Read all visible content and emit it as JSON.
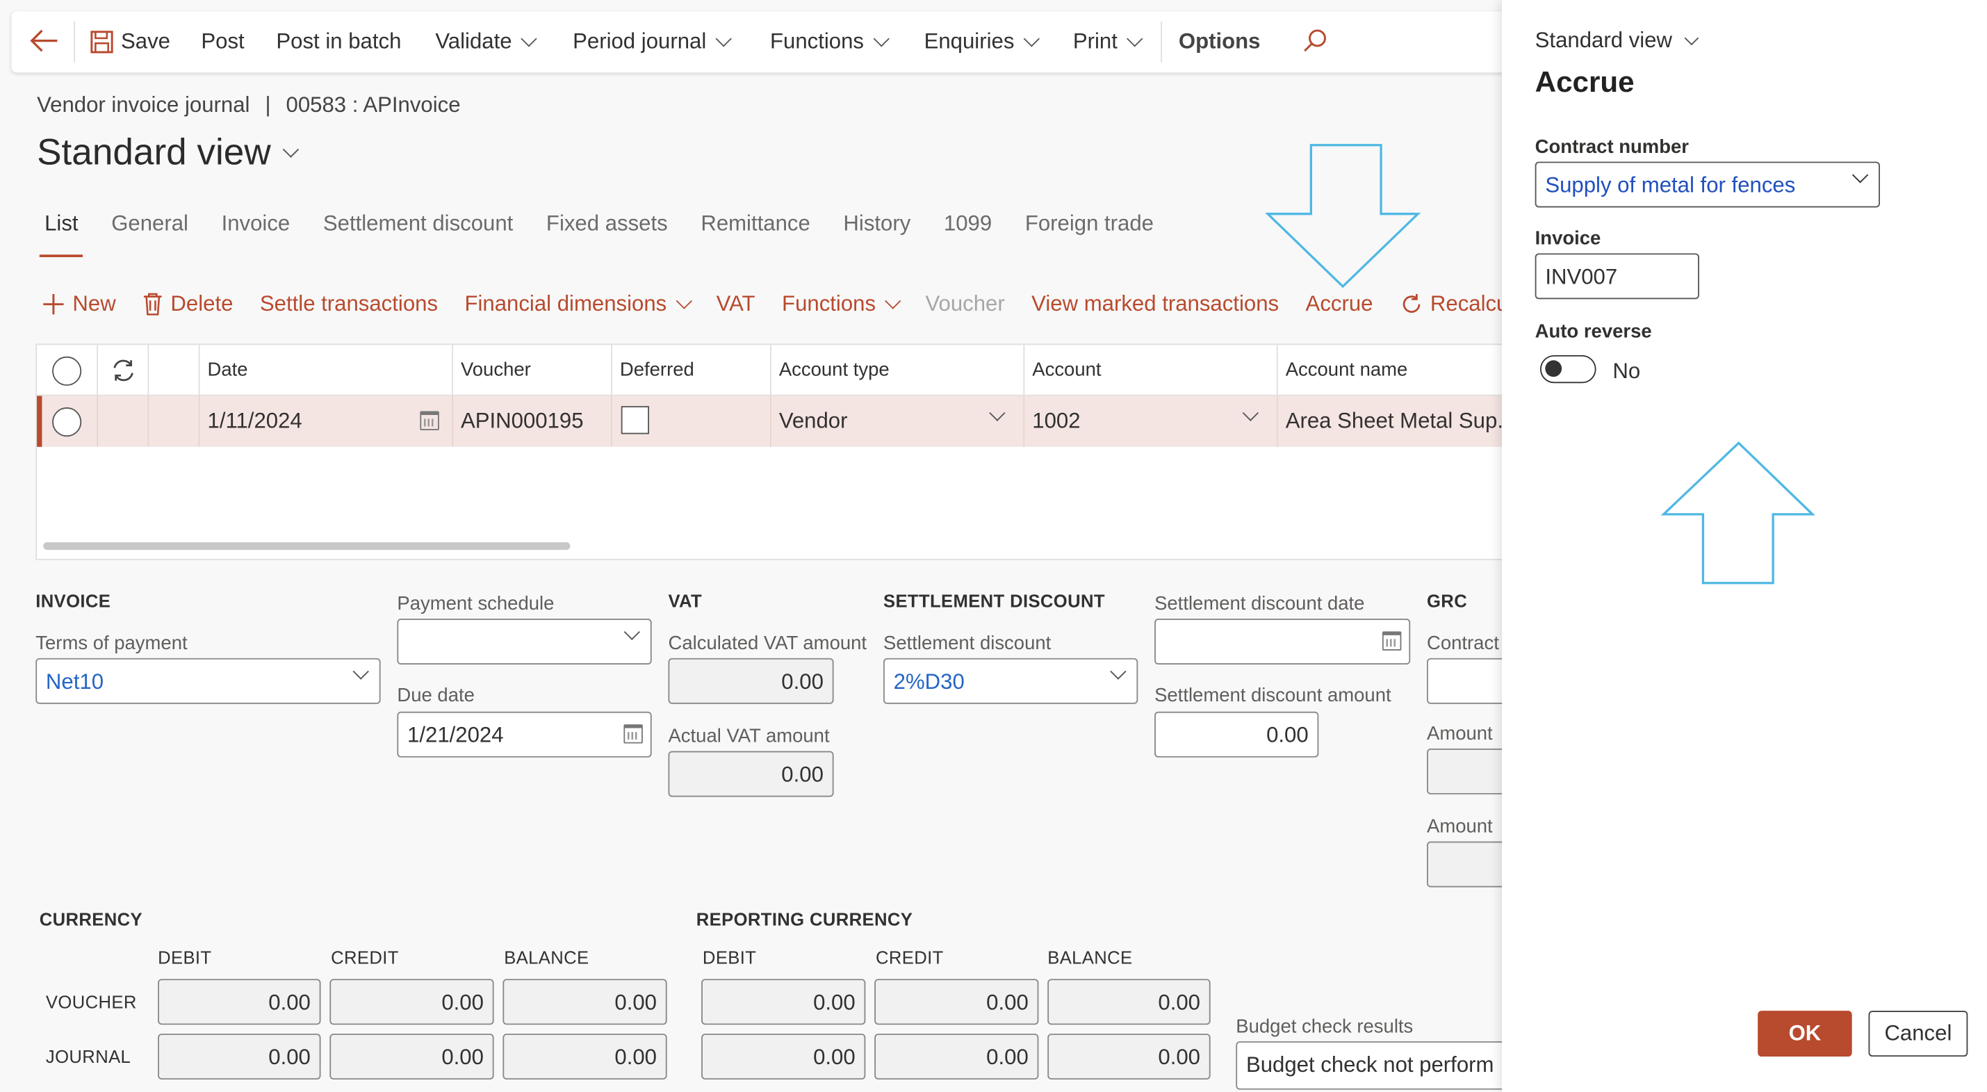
{
  "toolbar": {
    "save": "Save",
    "post": "Post",
    "post_in_batch": "Post in batch",
    "validate": "Validate",
    "period_journal": "Period journal",
    "functions": "Functions",
    "enquiries": "Enquiries",
    "print": "Print",
    "options": "Options",
    "icons": [
      "back-arrow-icon",
      "save-icon",
      "search-icon"
    ]
  },
  "breadcrumb": {
    "journal": "Vendor invoice journal",
    "separator": "|",
    "batch": "00583 : APInvoice"
  },
  "view_title": "Standard view",
  "tabs": [
    "List",
    "General",
    "Invoice",
    "Settlement discount",
    "Fixed assets",
    "Remittance",
    "History",
    "1099",
    "Foreign trade"
  ],
  "actions": {
    "new": "New",
    "delete": "Delete",
    "settle_transactions": "Settle transactions",
    "financial_dimensions": "Financial dimensions",
    "vat": "VAT",
    "functions": "Functions",
    "voucher": "Voucher",
    "view_marked_transactions": "View marked transactions",
    "accrue": "Accrue",
    "recalc": "Recalcu"
  },
  "grid": {
    "columns": [
      "Date",
      "Voucher",
      "Deferred",
      "Account type",
      "Account",
      "Account name"
    ],
    "rows": [
      {
        "date": "1/11/2024",
        "voucher": "APIN000195",
        "deferred": false,
        "account_type": "Vendor",
        "account": "1002",
        "account_name": "Area Sheet Metal Sup..."
      }
    ]
  },
  "invoice": {
    "heading": "INVOICE",
    "terms_label": "Terms of payment",
    "terms_value": "Net10",
    "payment_schedule_label": "Payment schedule",
    "payment_schedule_value": "",
    "due_date_label": "Due date",
    "due_date_value": "1/21/2024"
  },
  "vat": {
    "heading": "VAT",
    "calculated_label": "Calculated VAT amount",
    "calculated_value": "0.00",
    "actual_label": "Actual VAT amount",
    "actual_value": "0.00"
  },
  "settlement": {
    "heading": "SETTLEMENT DISCOUNT",
    "discount_label": "Settlement discount",
    "discount_value": "2%D30",
    "date_label": "Settlement discount date",
    "date_value": "",
    "amount_label": "Settlement discount amount",
    "amount_value": "0.00"
  },
  "grc": {
    "heading": "GRC",
    "contract_label": "Contract",
    "amount_label": "Amount",
    "amount2_label": "Amount"
  },
  "currency": {
    "heading": "CURRENCY",
    "cols": [
      "DEBIT",
      "CREDIT",
      "BALANCE"
    ],
    "voucher_label": "VOUCHER",
    "journal_label": "JOURNAL",
    "voucher": [
      "0.00",
      "0.00",
      "0.00"
    ],
    "journal": [
      "0.00",
      "0.00",
      "0.00"
    ]
  },
  "reporting_currency": {
    "heading": "REPORTING CURRENCY",
    "cols": [
      "DEBIT",
      "CREDIT",
      "BALANCE"
    ],
    "voucher": [
      "0.00",
      "0.00",
      "0.00"
    ],
    "journal": [
      "0.00",
      "0.00",
      "0.00"
    ]
  },
  "budget": {
    "label": "Budget check results",
    "value": "Budget check not perform"
  },
  "panel": {
    "view": "Standard view",
    "title": "Accrue",
    "contract_label": "Contract number",
    "contract_value": "Supply of metal for fences",
    "invoice_label": "Invoice",
    "invoice_value": "INV007",
    "auto_reverse_label": "Auto reverse",
    "auto_reverse_value": "No",
    "ok": "OK",
    "cancel": "Cancel"
  },
  "colors": {
    "accent": "#b84a2d",
    "link": "#2566c5",
    "annotation_arrow": "#4fb8e3",
    "row_selected": "#f4e5e2"
  }
}
